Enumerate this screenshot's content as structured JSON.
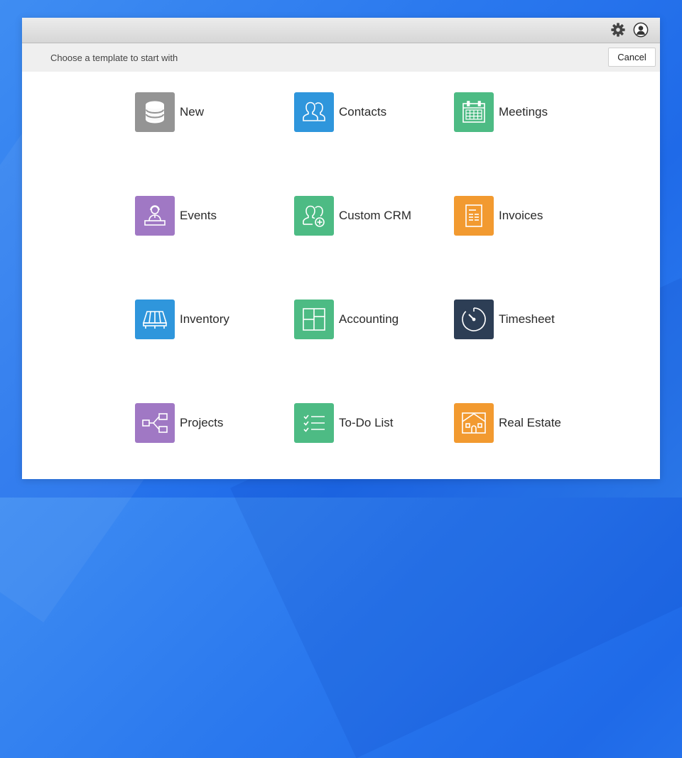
{
  "header": {
    "settings_icon": "gear-icon",
    "account_icon": "user-avatar-icon"
  },
  "toolbar": {
    "prompt": "Choose a template to start with",
    "cancel_label": "Cancel"
  },
  "templates": [
    {
      "label": "New",
      "icon": "database-icon",
      "color": "#949494"
    },
    {
      "label": "Contacts",
      "icon": "people-icon",
      "color": "#2f96dc"
    },
    {
      "label": "Meetings",
      "icon": "calendar-icon",
      "color": "#4dbb84"
    },
    {
      "label": "Events",
      "icon": "presenter-icon",
      "color": "#a078c4"
    },
    {
      "label": "Custom CRM",
      "icon": "add-person-icon",
      "color": "#4dbb84"
    },
    {
      "label": "Invoices",
      "icon": "document-icon",
      "color": "#f29a30"
    },
    {
      "label": "Inventory",
      "icon": "pallet-icon",
      "color": "#2f96dc"
    },
    {
      "label": "Accounting",
      "icon": "ledger-icon",
      "color": "#4dbb84"
    },
    {
      "label": "Timesheet",
      "icon": "stopwatch-icon",
      "color": "#2d3e55"
    },
    {
      "label": "Projects",
      "icon": "flowchart-icon",
      "color": "#a078c4"
    },
    {
      "label": "To-Do List",
      "icon": "checklist-icon",
      "color": "#4dbb84"
    },
    {
      "label": "Real Estate",
      "icon": "house-icon",
      "color": "#f29a30"
    }
  ]
}
